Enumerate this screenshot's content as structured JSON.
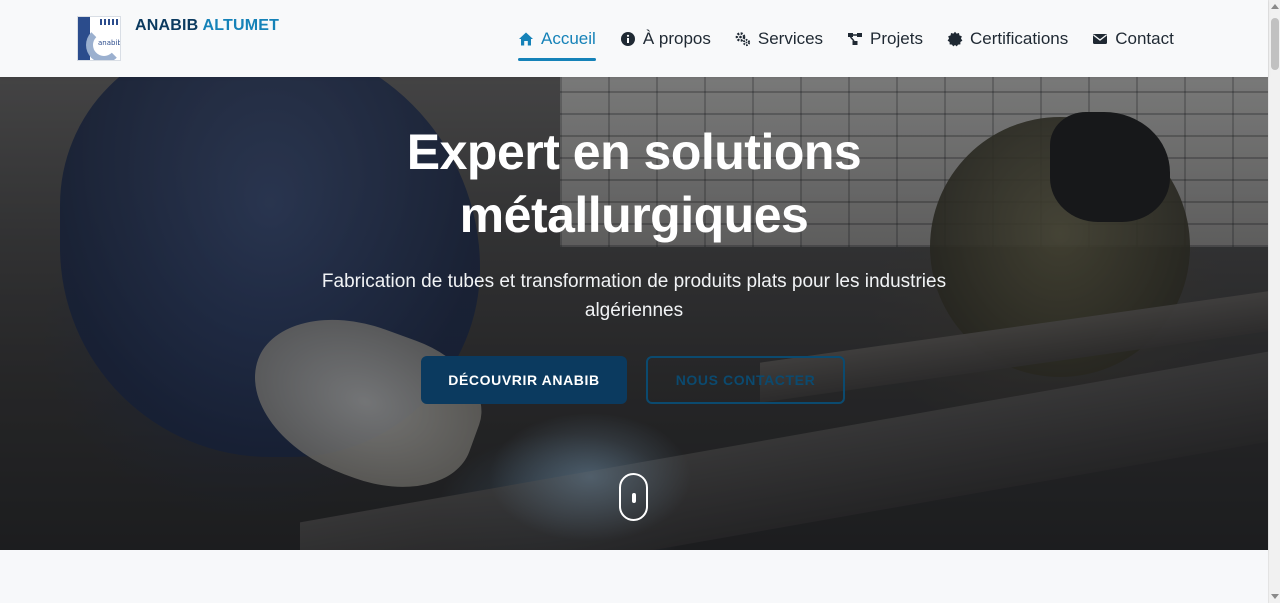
{
  "brand": {
    "name_part1": "ANABIB",
    "name_part2": "ALTUMET",
    "logo_text": "anabib"
  },
  "nav": {
    "items": [
      {
        "label": "Accueil",
        "icon": "home-icon",
        "active": true
      },
      {
        "label": "À propos",
        "icon": "info-circle-icon",
        "active": false
      },
      {
        "label": "Services",
        "icon": "gears-icon",
        "active": false
      },
      {
        "label": "Projets",
        "icon": "project-diagram-icon",
        "active": false
      },
      {
        "label": "Certifications",
        "icon": "certificate-icon",
        "active": false
      },
      {
        "label": "Contact",
        "icon": "envelope-icon",
        "active": false
      }
    ]
  },
  "hero": {
    "title_line1": "Expert en solutions",
    "title_line2": "métallurgiques",
    "subtitle_line1": "Fabrication de tubes et transformation de produits plats pour les industries",
    "subtitle_line2": "algériennes",
    "primary_button": "DÉCOUVRIR ANABIB",
    "secondary_button": "NOUS CONTACTER"
  },
  "colors": {
    "primary": "#0b3a5f",
    "accent": "#1582b8",
    "nav_text": "#1f2933",
    "header_bg": "#f8f9fa"
  }
}
